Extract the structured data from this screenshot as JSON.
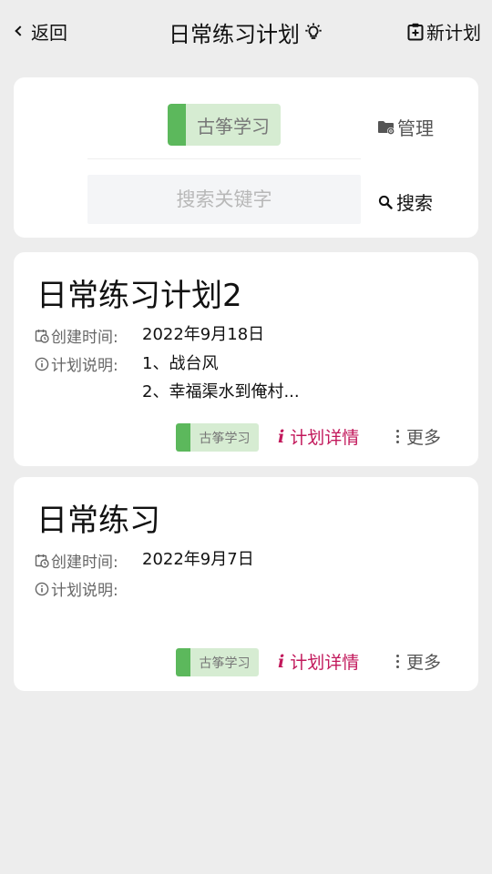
{
  "header": {
    "back_label": "返回",
    "title": "日常练习计划",
    "new_plan_label": "新计划"
  },
  "filter": {
    "tag_label": "古筝学习",
    "manage_label": "管理",
    "search_placeholder": "搜索关键字",
    "search_value": "",
    "search_button_label": "搜索"
  },
  "plans": [
    {
      "title": "日常练习计划2",
      "created_label": "创建时间:",
      "created_value": "2022年9月18日",
      "desc_label": "计划说明:",
      "desc_lines": [
        "1、战台风",
        "2、幸福渠水到俺村..."
      ],
      "tag_label": "古筝学习",
      "detail_label": "计划详情",
      "more_label": "更多"
    },
    {
      "title": "日常练习",
      "created_label": "创建时间:",
      "created_value": "2022年9月7日",
      "desc_label": "计划说明:",
      "desc_lines": [
        "",
        ""
      ],
      "tag_label": "古筝学习",
      "detail_label": "计划详情",
      "more_label": "更多"
    }
  ],
  "colors": {
    "accent": "#c2185b",
    "tag_bar": "#5cb85c",
    "tag_bg": "#d6ecd2",
    "background": "#ededed"
  },
  "icons": {
    "back": "chevron-left-icon",
    "title": "lightbulb-icon",
    "new_plan": "clipboard-plus-icon",
    "manage": "folder-gear-icon",
    "search": "magnifier-icon",
    "created": "calendar-clock-icon",
    "desc": "info-circle-icon",
    "detail": "italic-i-icon",
    "more": "vertical-dots-icon"
  }
}
